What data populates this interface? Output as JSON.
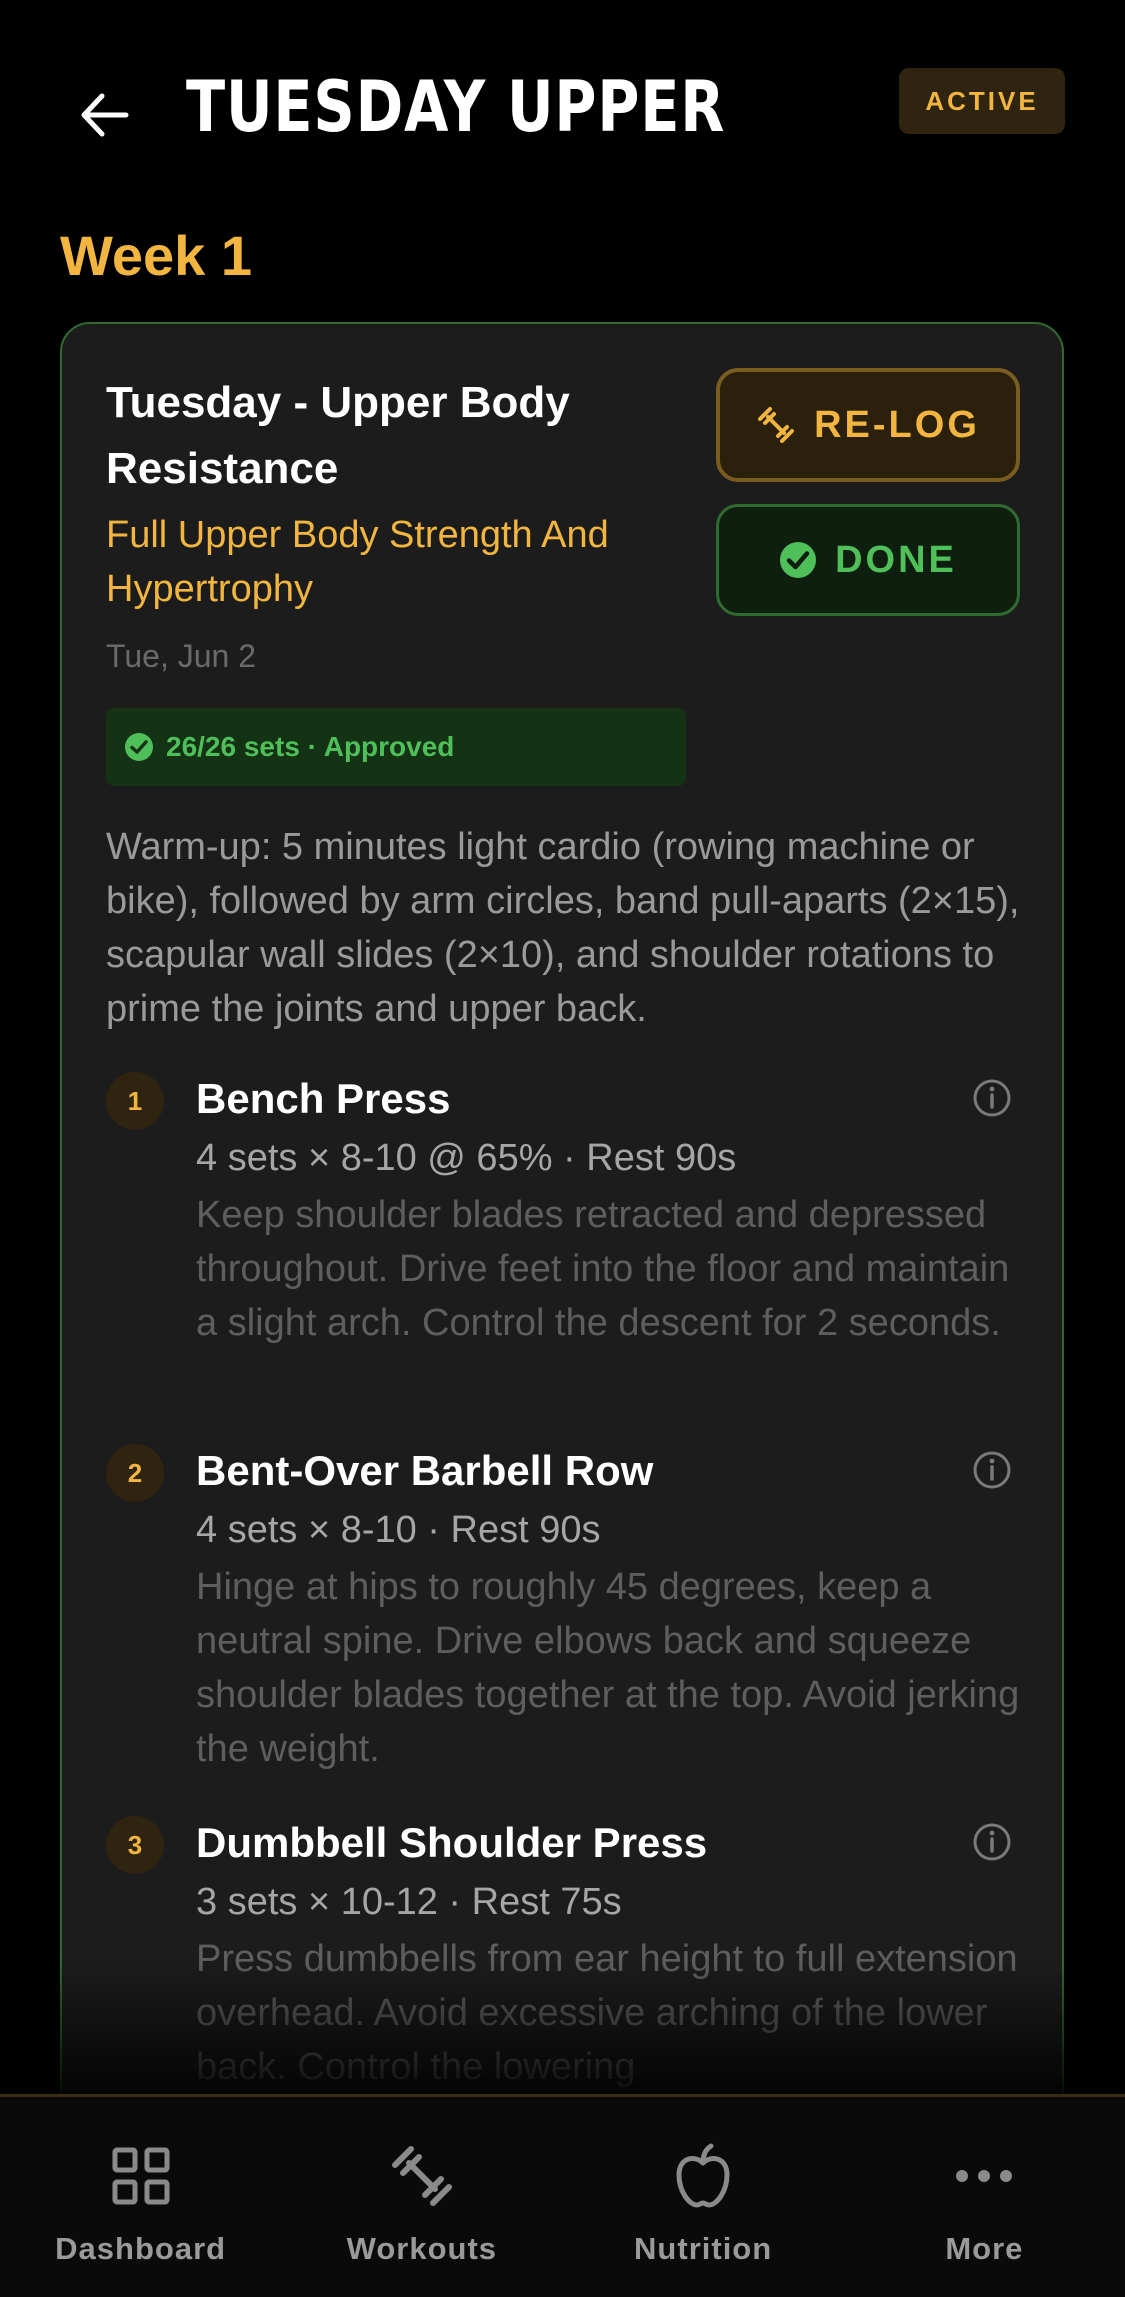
{
  "header": {
    "title": "TUESDAY UPPER",
    "status": "ACTIVE"
  },
  "week_label": "Week 1",
  "workout": {
    "title": "Tuesday - Upper Body Resistance",
    "subtitle": "Full Upper Body Strength And Hypertrophy",
    "date": "Tue, Jun 2",
    "sets_status": "26/26 sets · Approved",
    "relog_label": "RE-LOG",
    "done_label": "DONE",
    "warmup": "Warm-up: 5 minutes light cardio (rowing machine or bike), followed by arm circles, band pull-aparts (2×15), scapular wall slides (2×10), and shoulder rotations to prime the joints and upper back.",
    "exercises": [
      {
        "number": "1",
        "name": "Bench Press",
        "meta": "4 sets × 8-10 @ 65% · Rest 90s",
        "notes": "Keep shoulder blades retracted and depressed throughout. Drive feet into the floor and maintain a slight arch. Control the descent for 2 seconds."
      },
      {
        "number": "2",
        "name": "Bent-Over Barbell Row",
        "meta": "4 sets × 8-10 · Rest 90s",
        "notes": "Hinge at hips to roughly 45 degrees, keep a neutral spine. Drive elbows back and squeeze shoulder blades together at the top. Avoid jerking the weight."
      },
      {
        "number": "3",
        "name": "Dumbbell Shoulder Press",
        "meta": "3 sets × 10-12 · Rest 75s",
        "notes": "Press dumbbells from ear height to full extension overhead. Avoid excessive arching of the lower back. Control the lowering"
      }
    ]
  },
  "nav": {
    "items": [
      {
        "label": "Dashboard",
        "icon": "grid-icon"
      },
      {
        "label": "Workouts",
        "icon": "dumbbell-icon"
      },
      {
        "label": "Nutrition",
        "icon": "apple-icon"
      },
      {
        "label": "More",
        "icon": "ellipsis-icon"
      }
    ]
  },
  "colors": {
    "accent": "#f2b640",
    "success": "#4fbf5a",
    "background": "#000000",
    "card": "#1c1c1c"
  }
}
